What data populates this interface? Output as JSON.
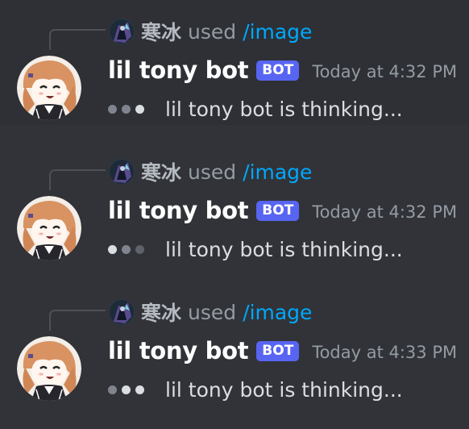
{
  "messages": [
    {
      "reply": {
        "user": "寒冰",
        "action": "used",
        "command": "/image"
      },
      "author": "lil tony bot",
      "badge": "BOT",
      "timestamp": "Today at 4:32 PM",
      "typing_dots": [
        "mid",
        "mid",
        "bright"
      ],
      "content": "lil tony bot is thinking..."
    },
    {
      "reply": {
        "user": "寒冰",
        "action": "used",
        "command": "/image"
      },
      "author": "lil tony bot",
      "badge": "BOT",
      "timestamp": "Today at 4:32 PM",
      "typing_dots": [
        "bright",
        "mid",
        "dim"
      ],
      "content": "lil tony bot is thinking..."
    },
    {
      "reply": {
        "user": "寒冰",
        "action": "used",
        "command": "/image"
      },
      "author": "lil tony bot",
      "badge": "BOT",
      "timestamp": "Today at 4:33 PM",
      "typing_dots": [
        "mid",
        "bright",
        "bright"
      ],
      "content": "lil tony bot is thinking..."
    }
  ],
  "colors": {
    "background": "#313338",
    "hover_background": "#2e3035",
    "bot_badge": "#5865f2",
    "command_link": "#00a8fc",
    "username": "#ffffff",
    "muted_text": "#949ba4"
  },
  "icons": {
    "reply_avatar": "user-avatar-icon",
    "bot_avatar": "bot-avatar-icon"
  }
}
